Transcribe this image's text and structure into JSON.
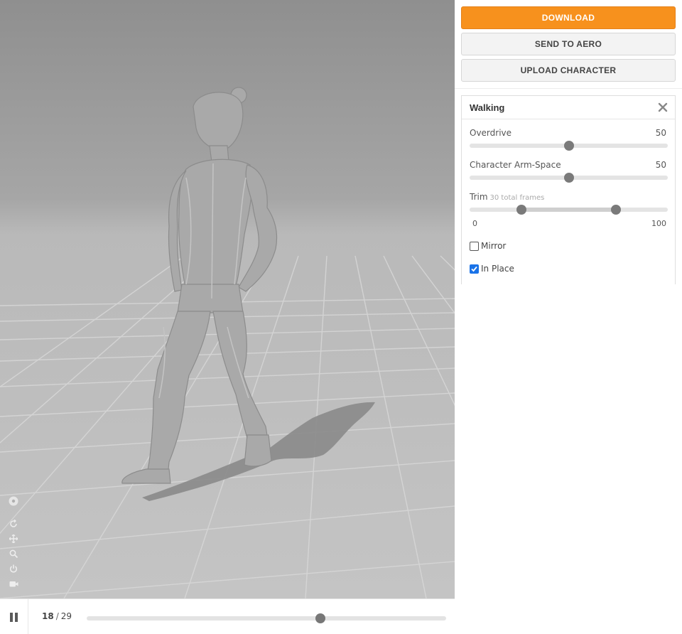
{
  "viewport": {
    "tools": [
      "eye-icon",
      "rotate-icon",
      "pan-icon",
      "zoom-icon",
      "power-icon",
      "camera-icon"
    ]
  },
  "timeline": {
    "current_frame": "18",
    "separator": "/",
    "total_frames": "29",
    "progress": 0.65
  },
  "actions": {
    "download": "DOWNLOAD",
    "send_to_aero": "SEND TO AERO",
    "upload_character": "UPLOAD CHARACTER"
  },
  "animation": {
    "title": "Walking",
    "overdrive": {
      "label": "Overdrive",
      "value": "50",
      "fraction": 0.5
    },
    "arm_space": {
      "label": "Character Arm-Space",
      "value": "50",
      "fraction": 0.5
    },
    "trim": {
      "label": "Trim",
      "note": "30 total frames",
      "min": "0",
      "max": "100",
      "start_fraction": 0.26,
      "end_fraction": 0.74
    },
    "mirror": {
      "label": "Mirror",
      "checked": false
    },
    "in_place": {
      "label": "In Place",
      "checked": true
    }
  },
  "colors": {
    "accent": "#f7911d",
    "checkbox": "#1a73e8"
  }
}
